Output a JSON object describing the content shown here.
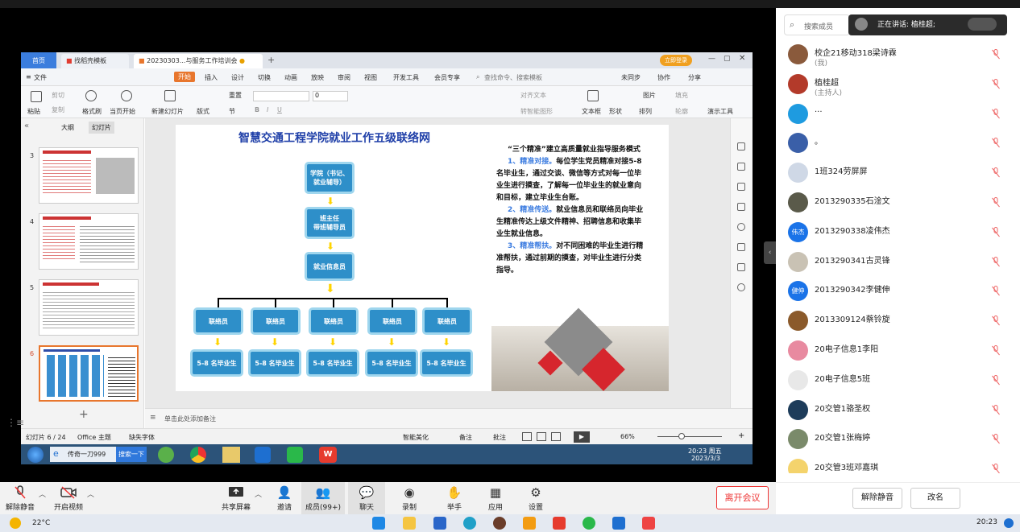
{
  "wps": {
    "tab_home": "首页",
    "tab_template": "找稻壳模板",
    "tab_doc": "20230303...与服务工作培训会",
    "login_button": "立即登录",
    "menu": [
      "文件",
      "开始",
      "插入",
      "设计",
      "切换",
      "动画",
      "放映",
      "审阅",
      "视图",
      "开发工具",
      "会员专享"
    ],
    "search_placeholder": "查找命令、搜索模板",
    "unsync": "未同步",
    "collab": "协作",
    "share": "分享",
    "ribbon": {
      "paste": "粘贴",
      "cut": "剪切",
      "copy": "复制",
      "format_painter": "格式刷",
      "start_from_current": "当页开始",
      "new_slide": "新建幻灯片",
      "layout": "版式",
      "section": "节",
      "reset": "重置",
      "font_size": "0",
      "align_text": "对齐文本",
      "smart_art": "转智能图形",
      "textbox": "文本框",
      "shape": "形状",
      "arrange": "排列",
      "picture": "图片",
      "fill": "填充",
      "outline": "轮廓",
      "presenter": "演示工具"
    },
    "panel_tabs": [
      "大纲",
      "幻灯片"
    ],
    "thumb_numbers": [
      "3",
      "4",
      "5",
      "6"
    ],
    "notes_placeholder": "单击此处添加备注",
    "status_slide": "幻灯片 6 / 24",
    "status_theme": "Office 主题",
    "status_font": "缺失字体",
    "status_smart": "智能美化",
    "status_notes": "备注",
    "status_comment": "批注",
    "zoom": "66%"
  },
  "slide": {
    "title": "智慧交通工程学院就业工作五级联络网",
    "box_top": "学院（书记、\n就业辅导）",
    "box_class": "班主任\n带班辅导员",
    "box_info": "就业信息员",
    "liaison_label": "联络员",
    "grad_label": "5-8 名毕业生",
    "right_heading": "“三个精准”建立高质量就业指导服务模式",
    "p1_lead": "1、精准对接。",
    "p1_body": "每位学生党员精准对接5-8名毕业生，通过交谈、微信等方式对每一位毕业生进行摸查，了解每一位毕业生的就业意向和目标，建立毕业生台账。",
    "p2_lead": "2、精准传送。",
    "p2_body": "就业信息员和联络员向毕业生精准传达上级文件精神、招聘信息和收集毕业生就业信息。",
    "p3_lead": "3、精准帮扶。",
    "p3_body": "对不同困难的毕业生进行精准帮扶，通过前期的摸查，对毕业生进行分类指导。"
  },
  "remote_taskbar": {
    "browser_item": "传奇一刀999",
    "search_button": "搜索一下",
    "time": "20:23 周五",
    "date": "2023/3/3"
  },
  "sidebar": {
    "search_placeholder": "搜索成员",
    "speaking": "正在讲话: 植桂超;",
    "members": [
      {
        "name": "校企21移动318梁诗霖",
        "role": "(我)",
        "avatar": "",
        "color": "#8a5a3c"
      },
      {
        "name": "植桂超",
        "role": "(主持人)",
        "avatar": "",
        "color": "#b33a2a"
      },
      {
        "name": "...",
        "role": "",
        "avatar": "",
        "color": "#1e9be0"
      },
      {
        "name": "。",
        "role": "",
        "avatar": "",
        "color": "#3a5fa8"
      },
      {
        "name": "1班324劳屏屏",
        "role": "",
        "avatar": "",
        "color": "#cfd8e6"
      },
      {
        "name": "2013290335石淦文",
        "role": "",
        "avatar": "",
        "color": "#5a5a4a"
      },
      {
        "name": "2013290338凌伟杰",
        "role": "",
        "avatar": "伟杰",
        "color": "#1a73e8"
      },
      {
        "name": "2013290341古灵锋",
        "role": "",
        "avatar": "",
        "color": "#c9c2b4"
      },
      {
        "name": "2013290342李健伸",
        "role": "",
        "avatar": "健伸",
        "color": "#1a73e8"
      },
      {
        "name": "2013309124蔡铃旋",
        "role": "",
        "avatar": "",
        "color": "#8b5a2b"
      },
      {
        "name": "20电子信息1李阳",
        "role": "",
        "avatar": "",
        "color": "#e88aa0"
      },
      {
        "name": "20电子信息5班",
        "role": "",
        "avatar": "",
        "color": "#e8e8e8"
      },
      {
        "name": "20交管1骆圣权",
        "role": "",
        "avatar": "",
        "color": "#1d3c5a"
      },
      {
        "name": "20交管1张梅婷",
        "role": "",
        "avatar": "",
        "color": "#7a8a6a"
      },
      {
        "name": "20交管3班邓嘉琪",
        "role": "",
        "avatar": "",
        "color": "#f4d36c"
      }
    ],
    "unmute_all": "解除静音",
    "rename": "改名"
  },
  "toolbar": {
    "unmute": "解除静音",
    "video": "开启视频",
    "share": "共享屏幕",
    "invite": "邀请",
    "members": "成员(99+)",
    "chat": "聊天",
    "record": "录制",
    "raise": "举手",
    "apps": "应用",
    "settings": "设置",
    "leave": "离开会议"
  },
  "taskbar": {
    "weather": "22°C",
    "time": "20:23"
  }
}
